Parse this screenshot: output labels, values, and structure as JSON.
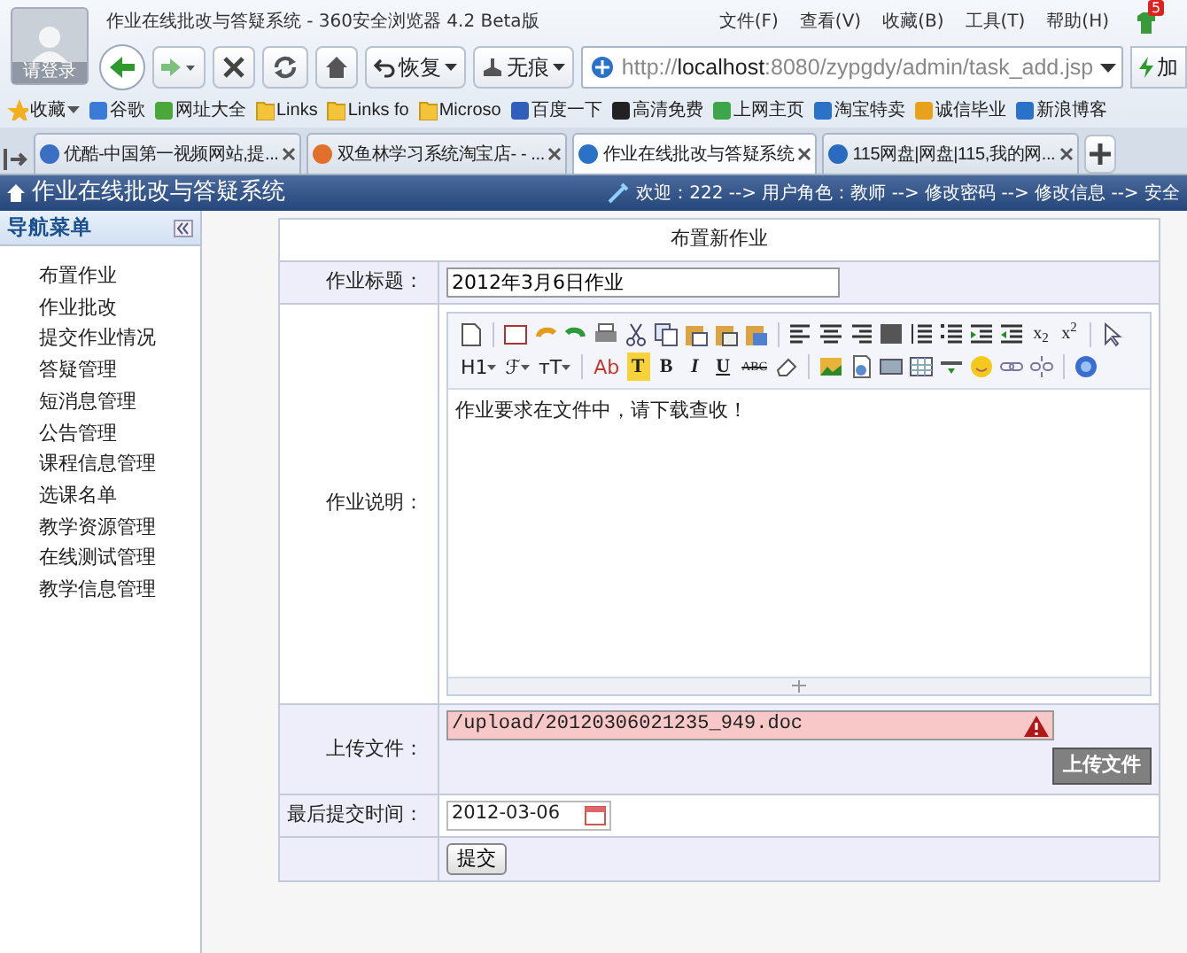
{
  "browser": {
    "title": "作业在线批改与答疑系统 - 360安全浏览器 4.2 Beta版",
    "avatar_label": "请登录",
    "menus": [
      "文件(F)",
      "查看(V)",
      "收藏(B)",
      "工具(T)",
      "帮助(H)"
    ],
    "update_badge": "5",
    "toolbar": {
      "restore": "恢复",
      "incognito": "无痕",
      "address": "http://**localhost**:8080/zypgdy/admin/task_add.jsp",
      "speed": "加"
    },
    "bookmarks": [
      {
        "kind": "favorites",
        "label": "收藏"
      },
      {
        "kind": "site",
        "label": "谷歌"
      },
      {
        "kind": "site",
        "label": "网址大全"
      },
      {
        "kind": "folder",
        "label": "Links"
      },
      {
        "kind": "folder",
        "label": "Links fo"
      },
      {
        "kind": "folder",
        "label": "Microso"
      },
      {
        "kind": "site",
        "label": "百度一下"
      },
      {
        "kind": "site",
        "label": "高清免费"
      },
      {
        "kind": "site",
        "label": "上网主页"
      },
      {
        "kind": "site",
        "label": "淘宝特卖"
      },
      {
        "kind": "site",
        "label": "诚信毕业"
      },
      {
        "kind": "site",
        "label": "新浪博客"
      }
    ],
    "tabs": [
      {
        "label": "优酷-中国第一视频网站,提...",
        "selected": false
      },
      {
        "label": "双鱼林学习系统淘宝店- - ...",
        "selected": false
      },
      {
        "label": "作业在线批改与答疑系统",
        "selected": true
      },
      {
        "label": "115网盘|网盘|115,我的网...",
        "selected": false
      }
    ]
  },
  "app": {
    "title": "作业在线批改与答疑系统",
    "user_bar": "欢迎：222 --> 用户角色：教师 --> 修改密码 --> 修改信息 --> 安全"
  },
  "sidebar": {
    "title": "导航菜单",
    "items": [
      {
        "label": "布置作业",
        "selected": false
      },
      {
        "label": "作业批改",
        "selected": false
      },
      {
        "label": "提交作业情况",
        "selected": false
      },
      {
        "label": "答疑管理",
        "selected": false
      },
      {
        "label": "短消息管理",
        "selected": false
      },
      {
        "label": "公告管理",
        "selected": false
      },
      {
        "label": "课程信息管理",
        "selected": false
      },
      {
        "label": "选课名单",
        "selected": false
      },
      {
        "label": "教学资源管理",
        "selected": false
      },
      {
        "label": "在线测试管理",
        "selected": false
      },
      {
        "label": "教学信息管理",
        "selected": false
      }
    ]
  },
  "form": {
    "heading": "布置新作业",
    "fields": [
      {
        "kind": "text",
        "label": "作业标题：",
        "value": "2012年3月6日作业"
      },
      {
        "kind": "editor",
        "label": "作业说明：",
        "value": "作业要求在文件中，请下载查收！",
        "toolbar": [
          [
            {
              "kind": "icon"
            },
            {
              "kind": "sep"
            },
            {
              "kind": "icon"
            },
            {
              "kind": "icon"
            },
            {
              "kind": "icon"
            },
            {
              "kind": "icon"
            },
            {
              "kind": "icon"
            },
            {
              "kind": "icon"
            },
            {
              "kind": "icon"
            },
            {
              "kind": "icon"
            },
            {
              "kind": "icon"
            },
            {
              "kind": "sep"
            },
            {
              "kind": "icon"
            },
            {
              "kind": "icon"
            },
            {
              "kind": "icon"
            },
            {
              "kind": "icon"
            },
            {
              "kind": "icon"
            },
            {
              "kind": "icon"
            },
            {
              "kind": "icon"
            },
            {
              "kind": "icon"
            },
            {
              "kind": "script",
              "label": "x$_{2}$"
            },
            {
              "kind": "script",
              "label": "x$^{2}$"
            },
            {
              "kind": "sep"
            },
            {
              "kind": "icon"
            }
          ],
          [
            {
              "kind": "dropdown",
              "label": "H1"
            },
            {
              "kind": "dropdown",
              "label": "ℱ"
            },
            {
              "kind": "dropdown",
              "label": "тT"
            },
            {
              "kind": "sep"
            },
            {
              "kind": "fontcolor",
              "label": "Ab"
            },
            {
              "kind": "bgcolor",
              "label": "T"
            },
            {
              "kind": "bold",
              "label": "B"
            },
            {
              "kind": "italic",
              "label": "I"
            },
            {
              "kind": "underline",
              "label": "U"
            },
            {
              "kind": "strike",
              "label": "ABC"
            },
            {
              "kind": "icon"
            },
            {
              "kind": "sep"
            },
            {
              "kind": "icon"
            },
            {
              "kind": "icon"
            },
            {
              "kind": "icon"
            },
            {
              "kind": "icon"
            },
            {
              "kind": "icon"
            },
            {
              "kind": "icon"
            },
            {
              "kind": "icon"
            },
            {
              "kind": "icon"
            },
            {
              "kind": "sep"
            },
            {
              "kind": "icon"
            }
          ]
        ]
      },
      {
        "kind": "upload",
        "label": "上传文件：",
        "value": "/upload/20120306021235_949.doc",
        "invalid": true,
        "button": "上传文件"
      },
      {
        "kind": "date",
        "label": "最后提交时间：",
        "value": "2012-03-06"
      },
      {
        "kind": "submit",
        "button": "提交"
      }
    ]
  }
}
